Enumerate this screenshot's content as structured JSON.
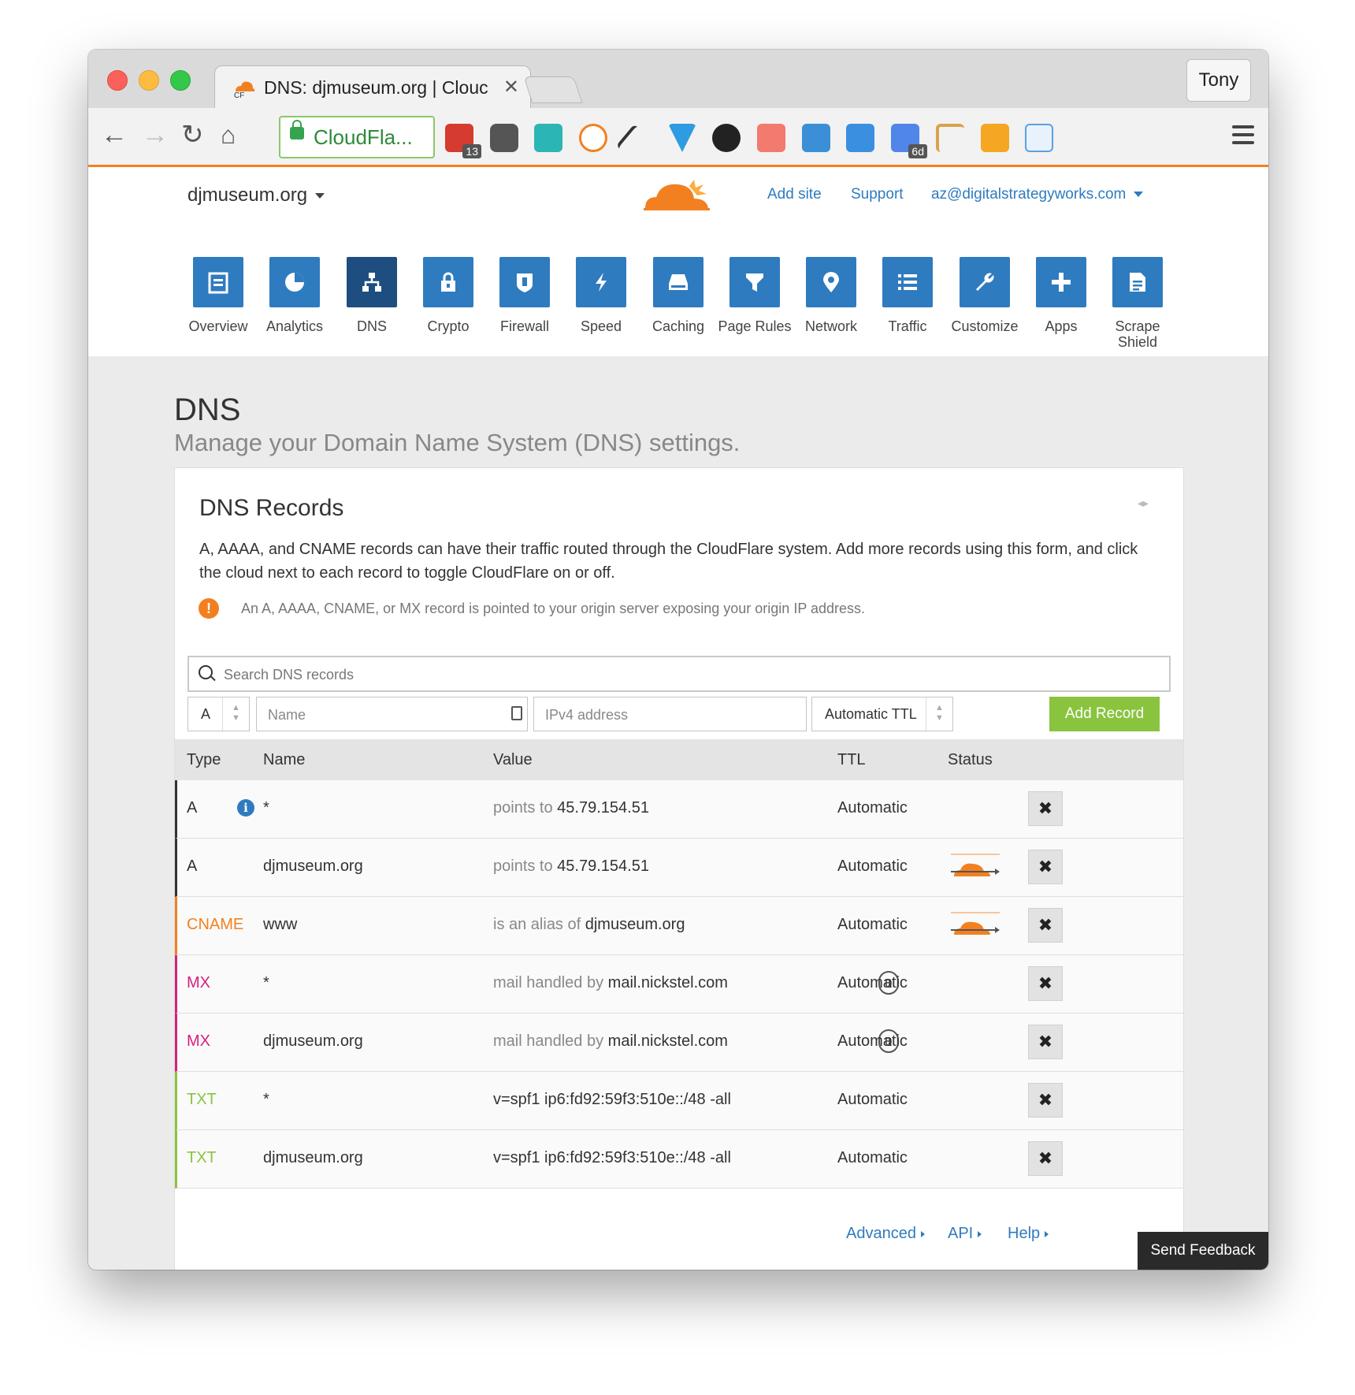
{
  "browser": {
    "tab_title": "DNS: djmuseum.org | Clouc",
    "profile": "Tony",
    "url_text": "CloudFla...",
    "badges": {
      "ext1": "13",
      "ext2": "6d"
    }
  },
  "header": {
    "site": "djmuseum.org",
    "add_site": "Add site",
    "support": "Support",
    "account": "az@digitalstrategyworks.com"
  },
  "nav": [
    {
      "label": "Overview",
      "icon": "overview-icon"
    },
    {
      "label": "Analytics",
      "icon": "analytics-icon"
    },
    {
      "label": "DNS",
      "icon": "dns-icon",
      "active": true
    },
    {
      "label": "Crypto",
      "icon": "crypto-icon"
    },
    {
      "label": "Firewall",
      "icon": "firewall-icon"
    },
    {
      "label": "Speed",
      "icon": "speed-icon"
    },
    {
      "label": "Caching",
      "icon": "caching-icon"
    },
    {
      "label": "Page Rules",
      "icon": "page-rules-icon"
    },
    {
      "label": "Network",
      "icon": "network-icon"
    },
    {
      "label": "Traffic",
      "icon": "traffic-icon"
    },
    {
      "label": "Customize",
      "icon": "customize-icon"
    },
    {
      "label": "Apps",
      "icon": "apps-icon"
    },
    {
      "label": "Scrape Shield",
      "icon": "scrape-shield-icon"
    }
  ],
  "page": {
    "title": "DNS",
    "subtitle": "Manage your Domain Name System (DNS) settings."
  },
  "card": {
    "title": "DNS Records",
    "description": "A, AAAA, and CNAME records can have their traffic routed through the CloudFlare system. Add more records using this form, and click the cloud next to each record to toggle CloudFlare on or off.",
    "warning": "An A, AAAA, CNAME, or MX record is pointed to your origin server exposing your origin IP address.",
    "search_placeholder": "Search DNS records",
    "form": {
      "type": "A",
      "name_placeholder": "Name",
      "value_placeholder": "IPv4 address",
      "ttl": "Automatic TTL",
      "add_button": "Add Record"
    },
    "columns": {
      "type": "Type",
      "name": "Name",
      "value": "Value",
      "ttl": "TTL",
      "status": "Status"
    },
    "records": [
      {
        "type": "A",
        "name": "*",
        "prefix": "points to",
        "value": "45.79.154.51",
        "ttl": "Automatic",
        "color": "#333333",
        "info": true
      },
      {
        "type": "A",
        "name": "djmuseum.org",
        "prefix": "points to",
        "value": "45.79.154.51",
        "ttl": "Automatic",
        "color": "#333333",
        "proxied": true
      },
      {
        "type": "CNAME",
        "name": "www",
        "prefix": "is an alias of",
        "value": "djmuseum.org",
        "ttl": "Automatic",
        "color": "#f38020",
        "proxied": true
      },
      {
        "type": "MX",
        "name": "*",
        "prefix": "mail handled by",
        "value": "mail.nickstel.com",
        "ttl": "Automatic",
        "color": "#d6207e",
        "priority": "0"
      },
      {
        "type": "MX",
        "name": "djmuseum.org",
        "prefix": "mail handled by",
        "value": "mail.nickstel.com",
        "ttl": "Automatic",
        "color": "#d6207e",
        "priority": "0"
      },
      {
        "type": "TXT",
        "name": "*",
        "prefix": "",
        "value": "v=spf1 ip6:fd92:59f3:510e::/48 -all",
        "ttl": "Automatic",
        "color": "#8ac43f"
      },
      {
        "type": "TXT",
        "name": "djmuseum.org",
        "prefix": "",
        "value": "v=spf1 ip6:fd92:59f3:510e::/48 -all",
        "ttl": "Automatic",
        "color": "#8ac43f"
      }
    ],
    "footer_links": {
      "advanced": "Advanced",
      "api": "API",
      "help": "Help"
    }
  },
  "feedback": "Send Feedback",
  "colors": {
    "accent": "#2f7bbf",
    "brand_orange": "#f38020",
    "add_green": "#8ac43f"
  }
}
